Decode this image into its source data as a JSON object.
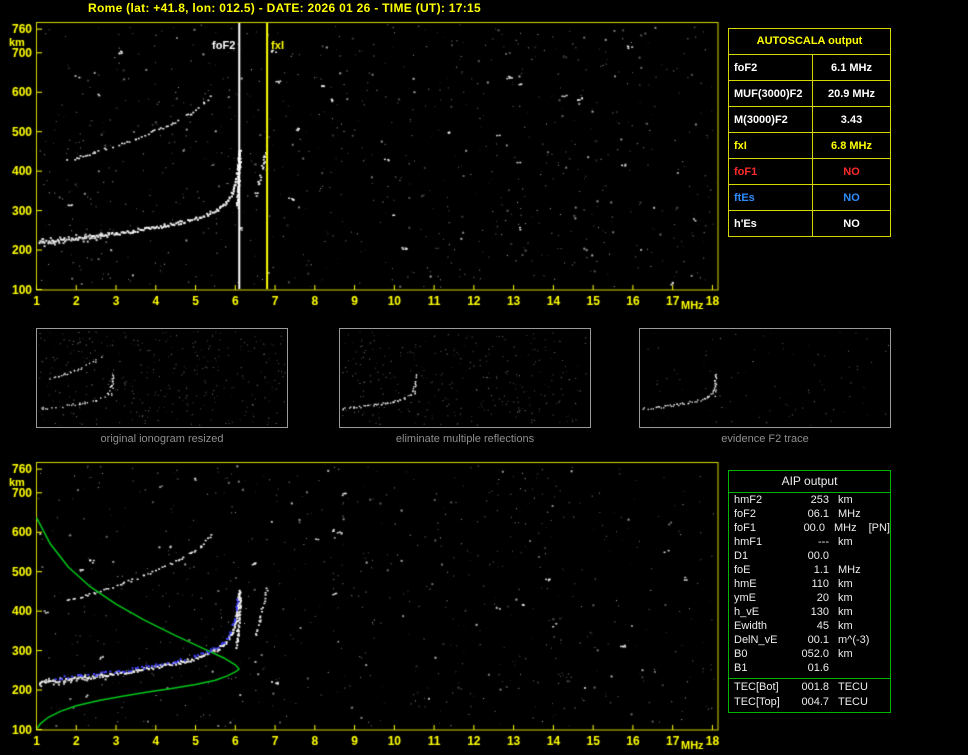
{
  "header": {
    "title": "Rome (lat: +41.8, lon: 012.5) - DATE: 2026 01 26 - TIME (UT): 17:15"
  },
  "colors": {
    "axis_yellow": "#ffff00",
    "grid_yellow": "#d6d600",
    "profile_green": "#00c818",
    "restored_blue": "#4040ff",
    "trace_white": "#f2f2f2",
    "alert_red": "#ff2a2a",
    "es_blue": "#2e8cff"
  },
  "autoscala": {
    "title": "AUTOSCALA output",
    "rows": [
      {
        "label": "foF2",
        "value": "6.1 MHz",
        "label_color": "#ffffff",
        "value_color": "#ffffff"
      },
      {
        "label": "MUF(3000)F2",
        "value": "20.9 MHz",
        "label_color": "#ffffff",
        "value_color": "#ffffff"
      },
      {
        "label": "M(3000)F2",
        "value": "3.43",
        "label_color": "#ffffff",
        "value_color": "#ffffff"
      },
      {
        "label": "fxI",
        "value": "6.8 MHz",
        "label_color": "#ffff00",
        "value_color": "#ffff00"
      },
      {
        "label": "foF1",
        "value": "NO",
        "label_color": "#ff2a2a",
        "value_color": "#ff2a2a"
      },
      {
        "label": "ftEs",
        "value": "NO",
        "label_color": "#2e8cff",
        "value_color": "#2e8cff"
      },
      {
        "label": "h'Es",
        "value": "NO",
        "label_color": "#ffffff",
        "value_color": "#ffffff"
      }
    ]
  },
  "aip": {
    "title": "AIP output",
    "rows": [
      {
        "label": "hmF2",
        "value": "253",
        "unit": "km",
        "extra": ""
      },
      {
        "label": "foF2",
        "value": "06.1",
        "unit": "MHz",
        "extra": ""
      },
      {
        "label": "foF1",
        "value": "00.0",
        "unit": "MHz",
        "extra": "[PN]"
      },
      {
        "label": "hmF1",
        "value": "---",
        "unit": "km",
        "extra": ""
      },
      {
        "label": "D1",
        "value": "00.0",
        "unit": "",
        "extra": ""
      },
      {
        "label": "foE",
        "value": "1.1",
        "unit": "MHz",
        "extra": ""
      },
      {
        "label": "hmE",
        "value": "110",
        "unit": "km",
        "extra": ""
      },
      {
        "label": "ymE",
        "value": "20",
        "unit": "km",
        "extra": ""
      },
      {
        "label": "h_vE",
        "value": "130",
        "unit": "km",
        "extra": ""
      },
      {
        "label": "Ewidth",
        "value": "45",
        "unit": "km",
        "extra": ""
      },
      {
        "label": "DelN_vE",
        "value": "00.1",
        "unit": "m^(-3)",
        "extra": ""
      },
      {
        "label": "B0",
        "value": "052.0",
        "unit": "km",
        "extra": ""
      },
      {
        "label": "B1",
        "value": "01.6",
        "unit": "",
        "extra": ""
      }
    ],
    "tec_rows": [
      {
        "label": "TEC[Bot]",
        "value": "001.8",
        "unit": "TECU"
      },
      {
        "label": "TEC[Top]",
        "value": "004.7",
        "unit": "TECU"
      }
    ]
  },
  "thumbnails": [
    {
      "caption": "original ionogram resized"
    },
    {
      "caption": "eliminate multiple reflections"
    },
    {
      "caption": "evidence F2 trace"
    }
  ],
  "chart_data": {
    "type": "scatter",
    "title": "Ionogram with AUTOSCALA interpretation (virtual height vs frequency)",
    "xlabel": "MHz",
    "ylabel": "km",
    "x_range": [
      1,
      18
    ],
    "y_range": [
      100,
      760
    ],
    "x_ticks": [
      1,
      2,
      3,
      4,
      5,
      6,
      7,
      8,
      9,
      10,
      11,
      12,
      13,
      14,
      15,
      16,
      17,
      18
    ],
    "y_ticks": [
      100,
      200,
      300,
      400,
      500,
      600,
      700,
      760
    ],
    "top_plot": {
      "vlines": [
        {
          "mhz": 6.1,
          "label": "foF2",
          "color": "#ffffff",
          "align": "right"
        },
        {
          "mhz": 6.8,
          "label": "fxI",
          "color": "#ffff00",
          "align": "left"
        }
      ]
    },
    "bottom_plot": {
      "profile_color": "#00c818",
      "restored_color": "#4040ff"
    },
    "traces": {
      "f2_trace": [
        [
          1.05,
          221
        ],
        [
          1.4,
          225
        ],
        [
          1.8,
          229
        ],
        [
          2.2,
          233
        ],
        [
          2.6,
          238
        ],
        [
          3.0,
          244
        ],
        [
          3.4,
          250
        ],
        [
          3.8,
          257
        ],
        [
          4.2,
          264
        ],
        [
          4.6,
          272
        ],
        [
          5.0,
          282
        ],
        [
          5.3,
          293
        ],
        [
          5.55,
          306
        ],
        [
          5.75,
          322
        ],
        [
          5.9,
          345
        ],
        [
          6.0,
          378
        ],
        [
          6.05,
          415
        ],
        [
          6.08,
          450
        ]
      ],
      "second_hop": [
        [
          1.75,
          428
        ],
        [
          2.1,
          438
        ],
        [
          2.45,
          449
        ],
        [
          2.8,
          460
        ],
        [
          3.15,
          472
        ],
        [
          3.5,
          485
        ],
        [
          3.85,
          499
        ],
        [
          4.2,
          514
        ],
        [
          4.55,
          531
        ],
        [
          4.85,
          548
        ],
        [
          5.1,
          565
        ],
        [
          5.28,
          582
        ],
        [
          5.4,
          598
        ]
      ],
      "cusp": [
        [
          6.03,
          310
        ],
        [
          6.05,
          350
        ],
        [
          6.07,
          390
        ],
        [
          6.09,
          425
        ],
        [
          6.1,
          455
        ]
      ],
      "x_cusp": [
        [
          6.5,
          340
        ],
        [
          6.58,
          375
        ],
        [
          6.66,
          410
        ],
        [
          6.73,
          440
        ],
        [
          6.78,
          458
        ]
      ],
      "profile_topside": [
        [
          1.0,
          637
        ],
        [
          1.35,
          570
        ],
        [
          1.8,
          512
        ],
        [
          2.35,
          462
        ],
        [
          3.0,
          418
        ],
        [
          3.7,
          378
        ],
        [
          4.5,
          338
        ],
        [
          5.2,
          305
        ],
        [
          5.7,
          282
        ],
        [
          6.0,
          264
        ],
        [
          6.1,
          253
        ]
      ],
      "profile_bottomside": [
        [
          6.1,
          253
        ],
        [
          6.0,
          246
        ],
        [
          5.8,
          236
        ],
        [
          5.5,
          225
        ],
        [
          5.0,
          214
        ],
        [
          4.4,
          204
        ],
        [
          3.8,
          195
        ],
        [
          3.2,
          185
        ],
        [
          2.6,
          174
        ],
        [
          2.0,
          160
        ],
        [
          1.6,
          146
        ],
        [
          1.3,
          131
        ],
        [
          1.1,
          115
        ],
        [
          1.02,
          103
        ]
      ],
      "restored_trace": [
        [
          1.5,
          224
        ],
        [
          2.1,
          230
        ],
        [
          2.7,
          237
        ],
        [
          3.3,
          245
        ],
        [
          3.9,
          255
        ],
        [
          4.5,
          267
        ],
        [
          5.0,
          280
        ],
        [
          5.4,
          294
        ],
        [
          5.7,
          312
        ],
        [
          5.88,
          338
        ],
        [
          5.98,
          370
        ],
        [
          6.04,
          405
        ],
        [
          6.07,
          432
        ]
      ]
    }
  }
}
